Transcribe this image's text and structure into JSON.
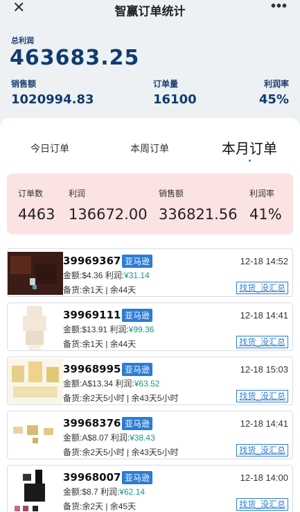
{
  "header": {
    "title": "智赢订单统计",
    "close_icon": "close-icon",
    "more_icon": "more-icon"
  },
  "totals": {
    "profit_label": "总利润",
    "profit_value": "463683.25",
    "sales_label": "销售额",
    "sales_value": "1020994.83",
    "orders_label": "订单量",
    "orders_value": "16100",
    "margin_label": "利润率",
    "margin_value": "45%"
  },
  "tabs": [
    {
      "label": "今日订单",
      "active": false
    },
    {
      "label": "本周订单",
      "active": false
    },
    {
      "label": "本月订单",
      "active": true
    }
  ],
  "summary": {
    "count_label": "订单数",
    "count_value": "4463",
    "profit_label": "利润",
    "profit_value": "136672.00",
    "sales_label": "销售额",
    "sales_value": "336821.56",
    "margin_label": "利润率",
    "margin_value": "41%"
  },
  "orders": [
    {
      "id": "39969367",
      "platform": "亚马逊",
      "time": "12-18 14:52",
      "amount_prefix": "金额:",
      "amount": "$4.36",
      "profit_prefix": "利润:",
      "profit": "¥31.14",
      "stock": "备货:余1天 | 余44天",
      "action": "找货_没汇总"
    },
    {
      "id": "39969111",
      "platform": "亚马逊",
      "time": "12-18 14:41",
      "amount_prefix": "金额:",
      "amount": "$13.91",
      "profit_prefix": "利润:",
      "profit": "¥99.36",
      "stock": "备货:余1天 | 余44天",
      "action": "找货_没汇总"
    },
    {
      "id": "39968995",
      "platform": "亚马逊",
      "time": "12-18 15:03",
      "amount_prefix": "金额:",
      "amount": "A$13.34",
      "profit_prefix": "利润:",
      "profit": "¥63.52",
      "stock": "备货:余2天5小时 | 余43天5小时",
      "action": "找货_没汇总"
    },
    {
      "id": "39968376",
      "platform": "亚马逊",
      "time": "12-18 14:41",
      "amount_prefix": "金额:",
      "amount": "A$8.07",
      "profit_prefix": "利润:",
      "profit": "¥38.43",
      "stock": "备货:余2天5小时 | 余43天5小时",
      "action": "找货_没汇总"
    },
    {
      "id": "39968007",
      "platform": "亚马逊",
      "time": "12-18 14:00",
      "amount_prefix": "金额:",
      "amount": "$8.7",
      "profit_prefix": "利润:",
      "profit": "¥62.14",
      "stock": "备货:余2天 | 余45天",
      "action": "找货_没汇总"
    }
  ]
}
